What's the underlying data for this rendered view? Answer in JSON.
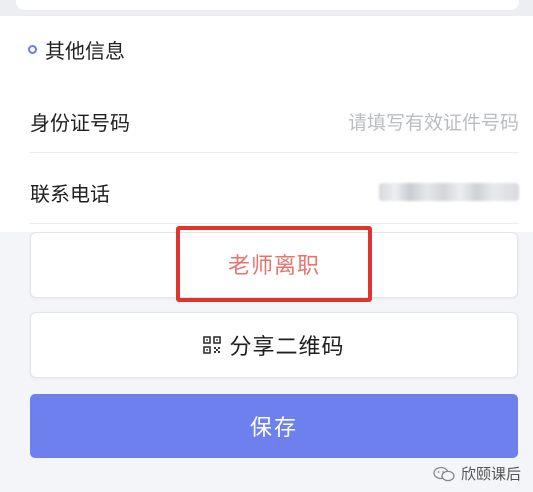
{
  "section": {
    "title": "其他信息"
  },
  "form": {
    "id_number": {
      "label": "身份证号码",
      "placeholder": "请填写有效证件号码"
    },
    "phone": {
      "label": "联系电话"
    }
  },
  "buttons": {
    "resign": "老师离职",
    "share_qr": "分享二维码",
    "save": "保存"
  },
  "watermark": "欣颐课后",
  "colors": {
    "accent": "#6d80ed",
    "highlight_border": "#e0342f",
    "resign_text": "#e5746d"
  },
  "icons": {
    "share": "qr-code-icon",
    "section": "circle-dot-icon",
    "watermark": "wechat-icon"
  }
}
